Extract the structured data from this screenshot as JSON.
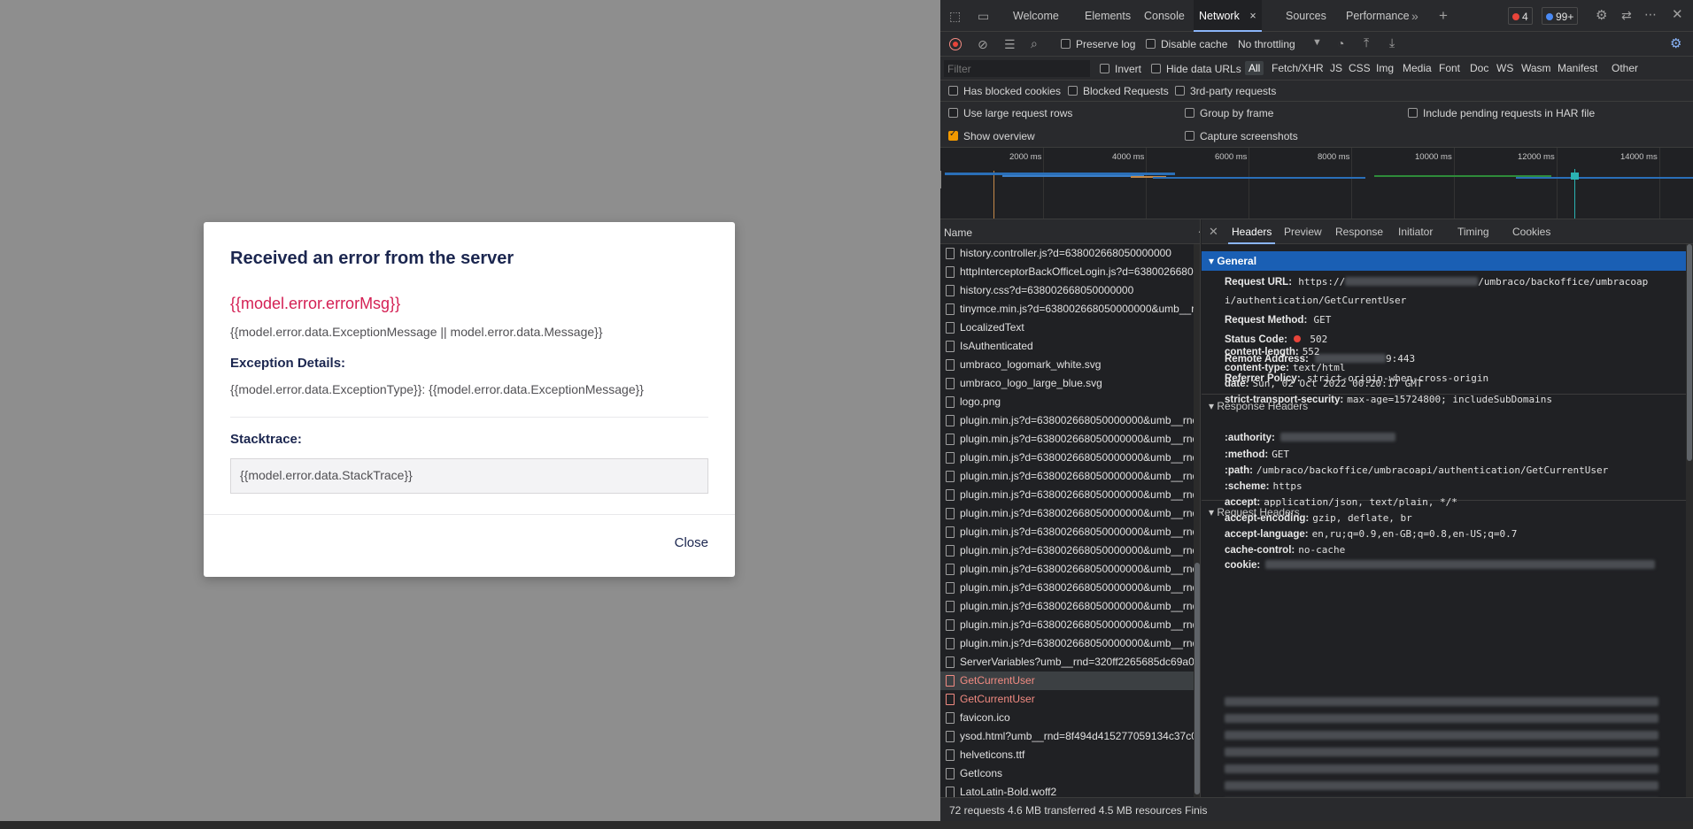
{
  "modal": {
    "title": "Received an error from the server",
    "error_msg": "{{model.error.errorMsg}}",
    "exception_message": "{{model.error.data.ExceptionMessage || model.error.data.Message}}",
    "exception_details_label": "Exception Details:",
    "exception_details": "{{model.error.data.ExceptionType}}: {{model.error.data.ExceptionMessage}}",
    "stacktrace_label": "Stacktrace:",
    "stacktrace": "{{model.error.data.StackTrace}}",
    "close_label": "Close"
  },
  "devtools": {
    "tabs": [
      "Welcome",
      "Elements",
      "Console",
      "Network",
      "Sources",
      "Performance"
    ],
    "active_tab": "Network",
    "errors_count": "4",
    "issues_count": "99+",
    "toolbar": {
      "preserve_log": "Preserve log",
      "disable_cache": "Disable cache",
      "throttling": "No throttling"
    },
    "filter": {
      "placeholder": "Filter",
      "invert": "Invert",
      "hide_data_urls": "Hide data URLs",
      "types": [
        "All",
        "Fetch/XHR",
        "JS",
        "CSS",
        "Img",
        "Media",
        "Font",
        "Doc",
        "WS",
        "Wasm",
        "Manifest",
        "Other"
      ],
      "active_type": "All"
    },
    "blocked": {
      "has_blocked_cookies": "Has blocked cookies",
      "blocked_requests": "Blocked Requests",
      "third_party": "3rd-party requests"
    },
    "settings": {
      "large_rows": "Use large request rows",
      "group_by_frame": "Group by frame",
      "include_pending": "Include pending requests in HAR file",
      "show_overview": "Show overview",
      "capture_screenshots": "Capture screenshots"
    },
    "overview_ticks": [
      "2000 ms",
      "4000 ms",
      "6000 ms",
      "8000 ms",
      "10000 ms",
      "12000 ms",
      "14000 ms"
    ],
    "list_header": "Name",
    "requests": [
      {
        "name": "history.controller.js?d=638002668050000000",
        "status": "ok"
      },
      {
        "name": "httpInterceptorBackOfficeLogin.js?d=6380026680",
        "status": "ok"
      },
      {
        "name": "history.css?d=638002668050000000",
        "status": "ok"
      },
      {
        "name": "tinymce.min.js?d=638002668050000000&umb__r...",
        "status": "ok"
      },
      {
        "name": "LocalizedText",
        "status": "ok"
      },
      {
        "name": "IsAuthenticated",
        "status": "ok"
      },
      {
        "name": "umbraco_logomark_white.svg",
        "status": "ok"
      },
      {
        "name": "umbraco_logo_large_blue.svg",
        "status": "ok"
      },
      {
        "name": "logo.png",
        "status": "ok"
      },
      {
        "name": "plugin.min.js?d=638002668050000000&umb__rnd",
        "status": "ok"
      },
      {
        "name": "plugin.min.js?d=638002668050000000&umb__rnd",
        "status": "ok"
      },
      {
        "name": "plugin.min.js?d=638002668050000000&umb__rnd",
        "status": "ok"
      },
      {
        "name": "plugin.min.js?d=638002668050000000&umb__rnd",
        "status": "ok"
      },
      {
        "name": "plugin.min.js?d=638002668050000000&umb__rnd",
        "status": "ok"
      },
      {
        "name": "plugin.min.js?d=638002668050000000&umb__rnd",
        "status": "ok"
      },
      {
        "name": "plugin.min.js?d=638002668050000000&umb__rnd",
        "status": "ok"
      },
      {
        "name": "plugin.min.js?d=638002668050000000&umb__rnd",
        "status": "ok"
      },
      {
        "name": "plugin.min.js?d=638002668050000000&umb__rnd",
        "status": "ok"
      },
      {
        "name": "plugin.min.js?d=638002668050000000&umb__rnd",
        "status": "ok"
      },
      {
        "name": "plugin.min.js?d=638002668050000000&umb__rnd",
        "status": "ok"
      },
      {
        "name": "plugin.min.js?d=638002668050000000&umb__rnd",
        "status": "ok"
      },
      {
        "name": "plugin.min.js?d=638002668050000000&umb__rnd",
        "status": "ok"
      },
      {
        "name": "ServerVariables?umb__rnd=320ff2265685dc69a02",
        "status": "ok"
      },
      {
        "name": "GetCurrentUser",
        "status": "selected"
      },
      {
        "name": "GetCurrentUser",
        "status": "error"
      },
      {
        "name": "favicon.ico",
        "status": "ok"
      },
      {
        "name": "ysod.html?umb__rnd=8f494d415277059134c37c0",
        "status": "ok"
      },
      {
        "name": "helveticons.ttf",
        "status": "ok"
      },
      {
        "name": "GetIcons",
        "status": "ok"
      },
      {
        "name": "LatoLatin-Bold.woff2",
        "status": "ok"
      }
    ],
    "detail_tabs": [
      "Headers",
      "Preview",
      "Response",
      "Initiator",
      "Timing",
      "Cookies"
    ],
    "active_detail_tab": "Headers",
    "general": {
      "title": "General",
      "request_url_label": "Request URL:",
      "request_url_prefix": "https://",
      "request_url_suffix": "/umbraco/backoffice/umbracoap",
      "request_url_line2": "i/authentication/GetCurrentUser",
      "request_method_label": "Request Method:",
      "request_method": "GET",
      "status_code_label": "Status Code:",
      "status_code": "502",
      "remote_address_label": "Remote Address:",
      "remote_address_suffix": "9:443",
      "referrer_policy_label": "Referrer Policy:",
      "referrer_policy": "strict-origin-when-cross-origin"
    },
    "response_headers": {
      "title": "Response Headers",
      "items": [
        {
          "k": "content-length:",
          "v": "552"
        },
        {
          "k": "content-type:",
          "v": "text/html"
        },
        {
          "k": "date:",
          "v": "Sun, 02 Oct 2022 00:20:17 GMT"
        },
        {
          "k": "strict-transport-security:",
          "v": "max-age=15724800; includeSubDomains"
        }
      ]
    },
    "request_headers": {
      "title": "Request Headers",
      "items": [
        {
          "k": ":authority:",
          "v": ""
        },
        {
          "k": ":method:",
          "v": "GET"
        },
        {
          "k": ":path:",
          "v": "/umbraco/backoffice/umbracoapi/authentication/GetCurrentUser"
        },
        {
          "k": ":scheme:",
          "v": "https"
        },
        {
          "k": "accept:",
          "v": "application/json, text/plain, */*"
        },
        {
          "k": "accept-encoding:",
          "v": "gzip, deflate, br"
        },
        {
          "k": "accept-language:",
          "v": "en,ru;q=0.9,en-GB;q=0.8,en-US;q=0.7"
        },
        {
          "k": "cache-control:",
          "v": "no-cache"
        },
        {
          "k": "cookie:",
          "v": ""
        }
      ]
    },
    "status_bar": "72 requests   4.6 MB transferred   4.5 MB resources   Finis"
  }
}
